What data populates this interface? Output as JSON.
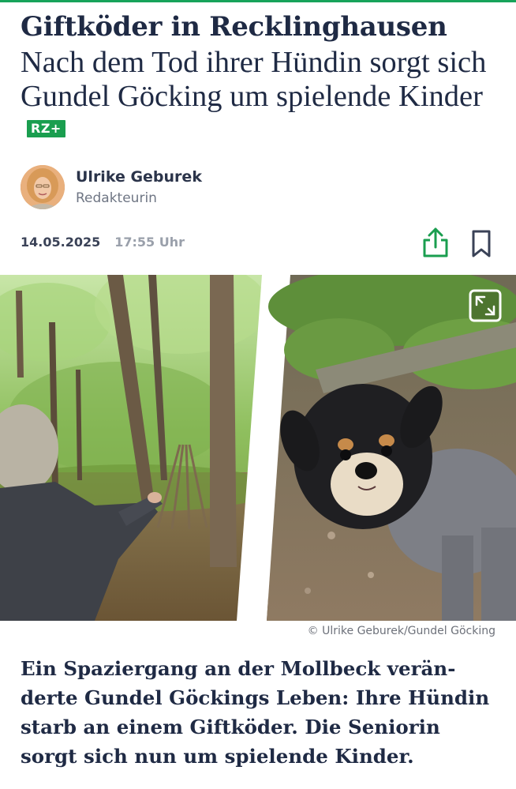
{
  "article": {
    "kicker": "Giftköder in Recklinghausen",
    "headline": "Nach dem Tod ihrer Hündin sorgt sich Gundel Göcking um spielende Kinder",
    "badge": "RZ+",
    "author": {
      "name": "Ulrike Geburek",
      "role": "Redakteurin"
    },
    "date": "14.05.2025",
    "time": "17:55 Uhr",
    "image_credit": "© Ulrike Geburek/Gundel Göcking",
    "teaser": "Ein Spaziergang an der Mollbeck verän-derte Gundel Göckings Leben: Ihre Hündin starb an einem Giftköder. Die Seniorin sorgt sich nun um spielende Kinder."
  },
  "icons": {
    "share": "share-icon",
    "bookmark": "bookmark-icon",
    "expand": "expand-icon"
  },
  "colors": {
    "accent_green": "#17a35a",
    "badge_green": "#1a9e4f",
    "headline_navy": "#1f2a44"
  }
}
